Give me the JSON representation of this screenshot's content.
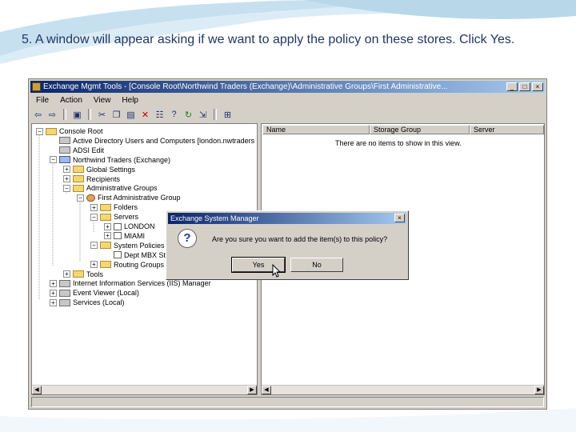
{
  "caption": "5. A window will appear asking if we want to apply the policy on these stores. Click Yes.",
  "window": {
    "title": "Exchange Mgmt Tools - [Console Root\\Northwind Traders (Exchange)\\Administrative Groups\\First Administrative..."
  },
  "menu": [
    "File",
    "Action",
    "View",
    "Help"
  ],
  "toolbar_icons": [
    "back-icon",
    "forward-icon",
    "up-folder-icon",
    "cut-icon",
    "copy-icon",
    "paste-icon",
    "delete-icon",
    "properties-icon",
    "help-icon",
    "refresh-icon",
    "export-icon",
    "help-book-icon"
  ],
  "tree": [
    {
      "label": "Console Root",
      "level": 0,
      "expander": "minus",
      "icon": "folder"
    },
    {
      "label": "Active Directory Users and Computers [london.nwtraders",
      "level": 1,
      "expander": "none",
      "icon": "ad"
    },
    {
      "label": "ADSI Edit",
      "level": 1,
      "expander": "none",
      "icon": "gray"
    },
    {
      "label": "Northwind Traders (Exchange)",
      "level": 1,
      "expander": "minus",
      "icon": "blue"
    },
    {
      "label": "Global Settings",
      "level": 2,
      "expander": "plus",
      "icon": "folder"
    },
    {
      "label": "Recipients",
      "level": 2,
      "expander": "plus",
      "icon": "folder"
    },
    {
      "label": "Administrative Groups",
      "level": 2,
      "expander": "minus",
      "icon": "folder"
    },
    {
      "label": "First Administrative Group",
      "level": 3,
      "expander": "minus",
      "icon": "orange"
    },
    {
      "label": "Folders",
      "level": 4,
      "expander": "plus",
      "icon": "folder"
    },
    {
      "label": "Servers",
      "level": 4,
      "expander": "minus",
      "icon": "folder"
    },
    {
      "label": "LONDON",
      "level": 5,
      "expander": "plus",
      "icon": "white"
    },
    {
      "label": "MIAMI",
      "level": 5,
      "expander": "plus",
      "icon": "white"
    },
    {
      "label": "System Policies",
      "level": 4,
      "expander": "minus",
      "icon": "folder"
    },
    {
      "label": "Dept MBX Stor",
      "level": 5,
      "expander": "none",
      "icon": "white"
    },
    {
      "label": "Routing Groups",
      "level": 4,
      "expander": "plus",
      "icon": "folder"
    },
    {
      "label": "Tools",
      "level": 2,
      "expander": "plus",
      "icon": "folder"
    },
    {
      "label": "Internet Information Services (IIS) Manager",
      "level": 1,
      "expander": "plus",
      "icon": "gray"
    },
    {
      "label": "Event Viewer (Local)",
      "level": 1,
      "expander": "plus",
      "icon": "gray"
    },
    {
      "label": "Services (Local)",
      "level": 1,
      "expander": "plus",
      "icon": "gray"
    }
  ],
  "list": {
    "columns": [
      "Name",
      "Storage Group",
      "Server"
    ],
    "empty_message": "There are no items to show in this view."
  },
  "dialog": {
    "title": "Exchange System Manager",
    "message": "Are you sure you want to add the item(s) to this policy?",
    "yes": "Yes",
    "no": "No"
  }
}
